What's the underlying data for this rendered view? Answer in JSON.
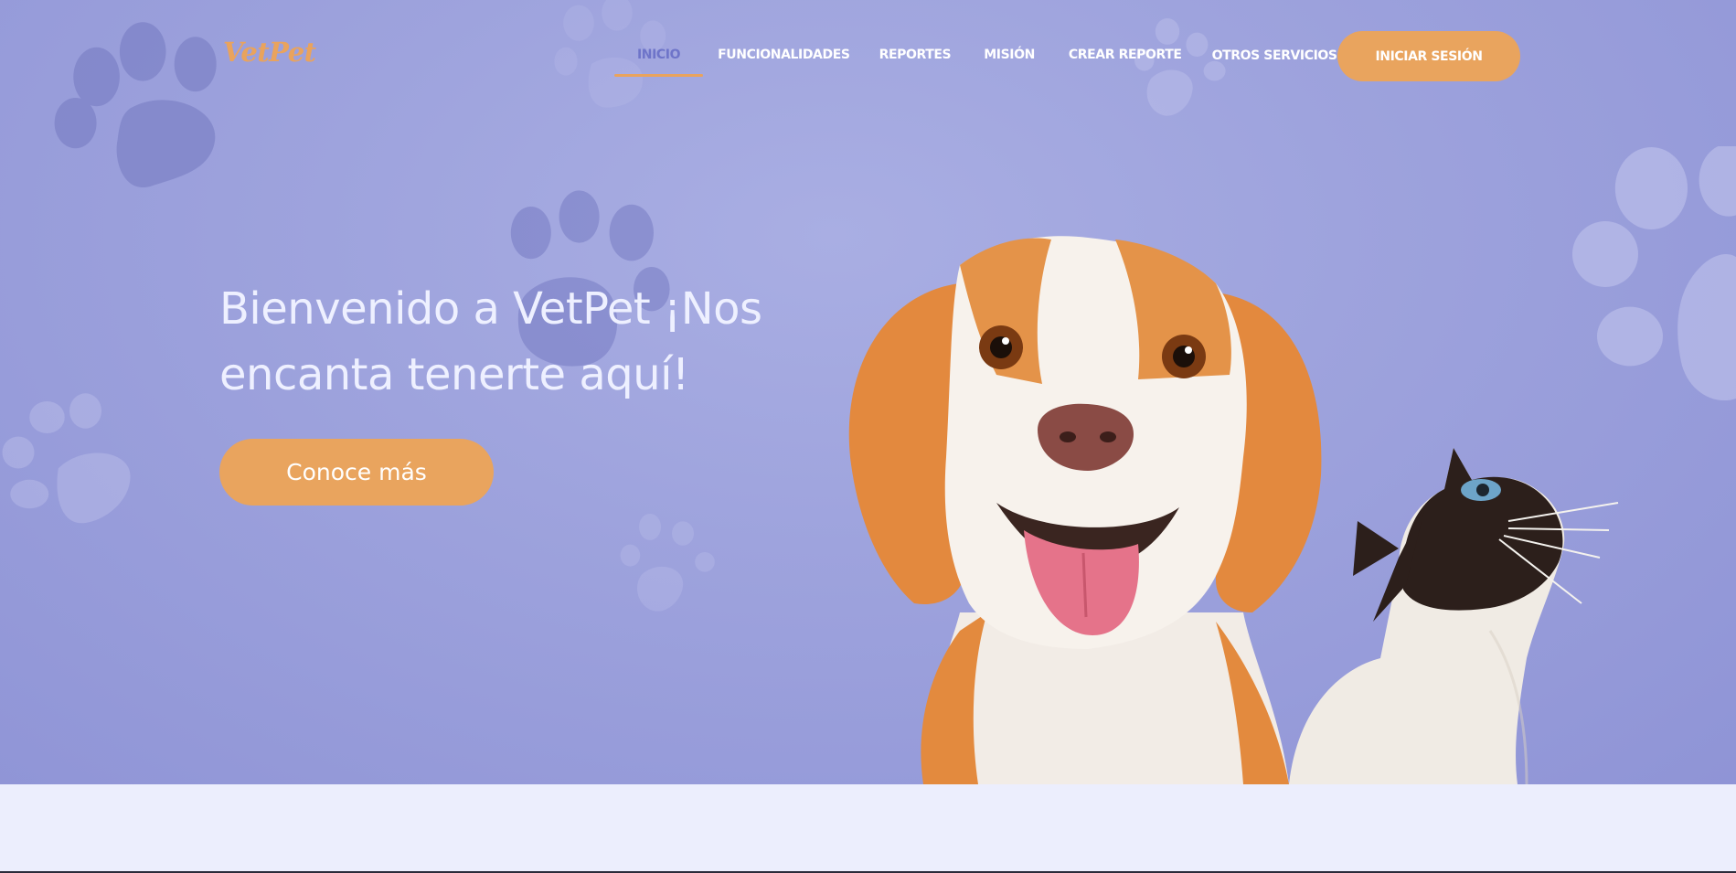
{
  "brand": {
    "logo_text": "VetPet"
  },
  "nav": {
    "items": [
      {
        "label": "INICIO",
        "active": true
      },
      {
        "label": "FUNCIONALIDADES"
      },
      {
        "label": "REPORTES"
      },
      {
        "label": "MISIÓN"
      },
      {
        "label": "CREAR REPORTE"
      },
      {
        "label": "OTROS SERVICIOS",
        "icon": "chevron-down-icon"
      }
    ],
    "login_label": "INICIAR SESIÓN"
  },
  "hero": {
    "headline": "Bienvenido a VetPet ¡Nos encanta tenerte aquí!",
    "cta_label": "Conoce más",
    "image": "dog-and-cat-photo"
  },
  "colors": {
    "hero_background": "#9ea3dd",
    "accent_orange": "#e9a45e",
    "active_nav": "#6e74c9",
    "page_background": "#eceefd"
  }
}
